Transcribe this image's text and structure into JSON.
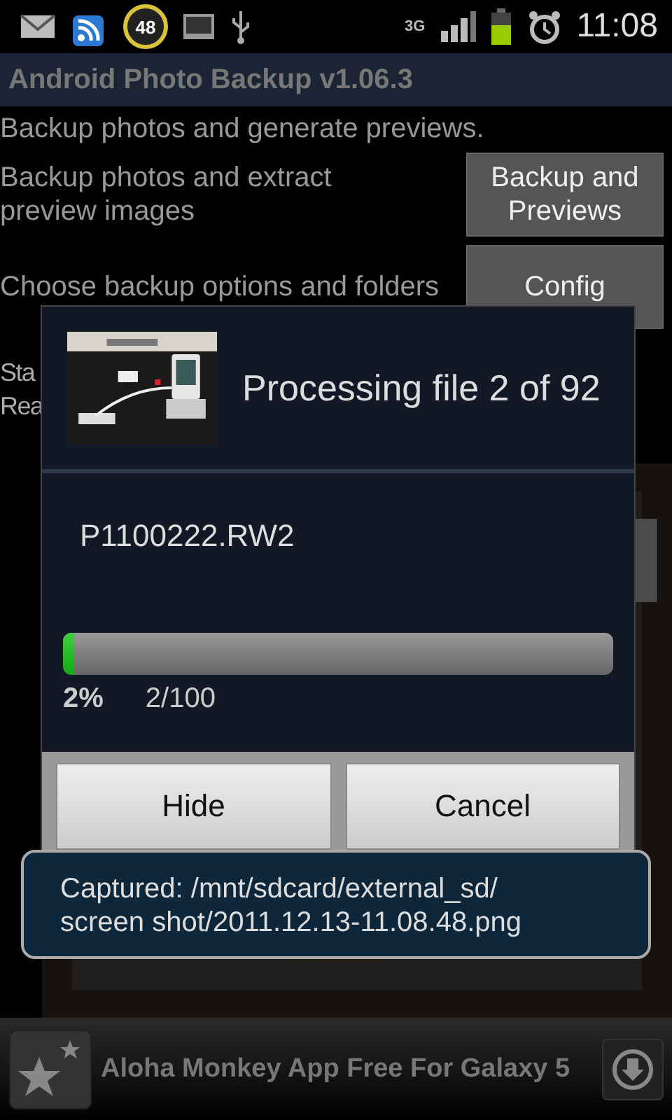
{
  "status_bar": {
    "notification_count": "48",
    "network": "3G",
    "time": "11:08"
  },
  "app_bar": {
    "title": "Android Photo Backup v1.06.3"
  },
  "main": {
    "intro": "Backup photos and generate previews.",
    "actions": [
      {
        "description_lines": [
          "Backup photos and extract",
          "preview images"
        ],
        "button_lines": [
          "Backup and",
          "Previews"
        ]
      },
      {
        "description_lines": [
          "Choose backup options and folders"
        ],
        "button_lines": [
          "Config"
        ]
      }
    ],
    "status_lines": [
      "Sta",
      "Rea"
    ]
  },
  "dialog": {
    "title": "Processing file 2 of 92",
    "filename": "P1100222.RW2",
    "progress": {
      "level": 0.02,
      "percent": "2%",
      "count": "2/100"
    },
    "buttons": [
      "Hide",
      "Cancel"
    ]
  },
  "toast": {
    "lines": [
      "Captured: /mnt/sdcard/external_sd/",
      "screen shot/2011.12.13-11.08.48.png"
    ]
  },
  "ad": {
    "text": "Aloha Monkey App Free For Galaxy 5"
  }
}
